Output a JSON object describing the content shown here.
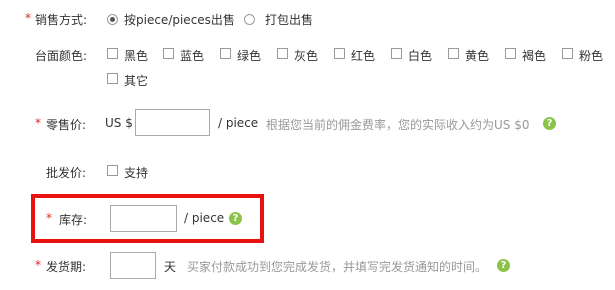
{
  "sales_method": {
    "label": "销售方式:",
    "options": [
      {
        "label": "按piece/pieces出售",
        "checked": true
      },
      {
        "label": "打包出售",
        "checked": false
      }
    ]
  },
  "countertop_color": {
    "label": "台面颜色:",
    "colors": [
      "黑色",
      "蓝色",
      "绿色",
      "灰色",
      "红色",
      "白色",
      "黄色",
      "褐色",
      "粉色",
      "其它"
    ]
  },
  "retail_price": {
    "label": "零售价:",
    "currency": "US $",
    "value": "",
    "unit": "/ piece",
    "hint": "根据您当前的佣金费率，您的实际收入约为US $0"
  },
  "wholesale_price": {
    "label": "批发价:",
    "option": "支持"
  },
  "stock": {
    "label": "库存:",
    "value": "",
    "unit": "/ piece"
  },
  "shipping": {
    "label": "发货期:",
    "value": "",
    "unit": "天",
    "hint": "买家付款成功到您完成发货，并填写完发货通知的时间。"
  },
  "required_mark": "*",
  "help_symbol": "?"
}
